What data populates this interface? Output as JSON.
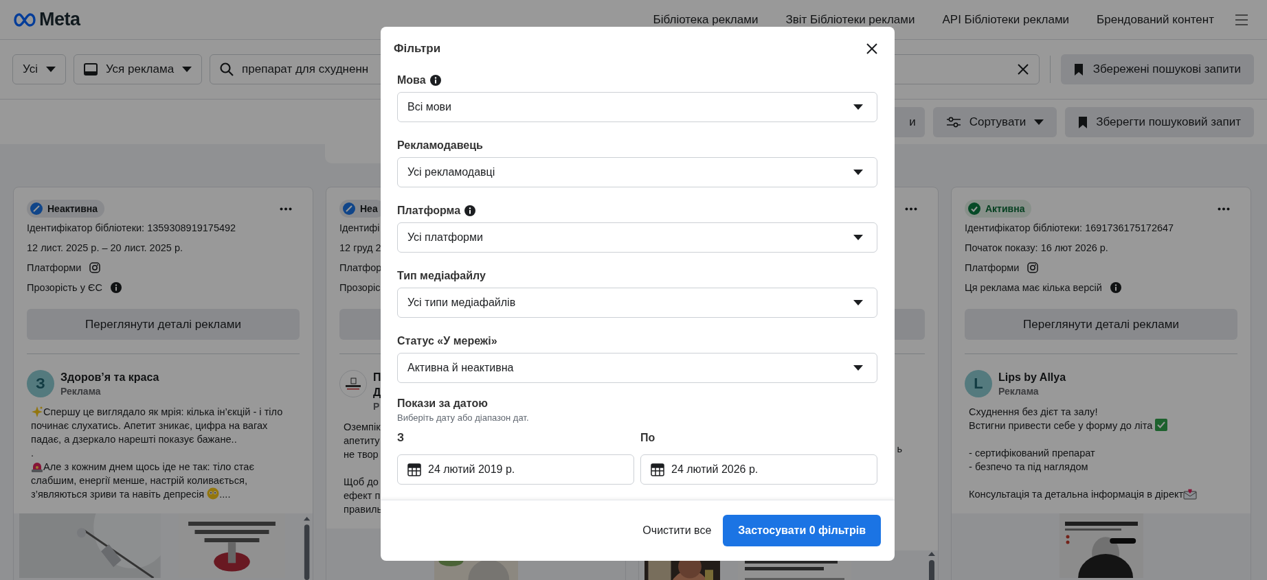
{
  "header": {
    "logo": "Meta",
    "nav": [
      "Бібліотека реклами",
      "Звіт Бібліотеки реклами",
      "API Бібліотеки реклами",
      "Брендований контент"
    ]
  },
  "search_bar": {
    "country": "Усі",
    "ad_category": "Уся реклама",
    "query": "препарат для схудненн",
    "saved_searches": "Збережені пошукові запити"
  },
  "filter_bar": {
    "buttons": [
      {
        "kind": "partial",
        "label": "и"
      },
      {
        "kind": "sort",
        "label": "Сортувати"
      },
      {
        "kind": "save",
        "label": "Зберегти пошуковий запит"
      }
    ]
  },
  "cards": [
    {
      "status": {
        "label": "Неактивна",
        "active": false
      },
      "lines": [
        {
          "kind": "plain",
          "text": "Ідентифікатор бібліотеки: 1359308919175492"
        },
        {
          "kind": "plain",
          "text": "12 лист. 2025 р. – 20 лист. 2025 р."
        },
        {
          "kind": "instagram",
          "text": "Платформи"
        },
        {
          "kind": "info",
          "text": "Прозорість у ЄС"
        }
      ],
      "details": "Переглянути деталі реклами",
      "advertiser": {
        "kind": "letter",
        "initial": "З",
        "name": "Здоров’я та краса",
        "label": "Реклама"
      },
      "post": [
        {
          "segments": [
            {
              "kind": "sparkle"
            },
            {
              "kind": "text",
              "text": "Спершу це виглядало як мрія: кілька ін’єкцій - і тіло починає слухатись. Апетит зникає, цифра на вагах падає, а дзеркало нарешті показує бажане..\n.\n"
            },
            {
              "kind": "siren"
            },
            {
              "kind": "text",
              "text": "Але з кожним днем щось іде не так: тіло стає слабшим, енергії менше, настрій коливається, з’являються зриви та навіть депресія "
            },
            {
              "kind": "flushed"
            },
            {
              "kind": "text",
              "text": "...."
            }
          ]
        }
      ],
      "media": [
        {
          "kind": "picture"
        },
        {
          "kind": "picture"
        }
      ]
    },
    {
      "status": {
        "label": "Неа",
        "active": false
      },
      "lines": [
        {
          "kind": "plain",
          "text": "Ідентифі"
        },
        {
          "kind": "plain",
          "text": "12 груд 2"
        },
        {
          "kind": "plain",
          "text": "Платфор"
        },
        {
          "kind": "plain",
          "text": "Прозоріс"
        }
      ],
      "advertiser": {
        "kind": "logo",
        "name": "П\nД",
        "label": "Р"
      },
      "post": [
        {
          "segments": [
            {
              "kind": "text",
              "text": "Оземпік\nапетиту\nне твор"
            }
          ]
        },
        {
          "segments": [
            {
              "kind": "text",
              "text": "Щоб до\nефект п\nправиль"
            }
          ]
        }
      ],
      "media": [
        {
          "kind": "picture"
        }
      ]
    },
    {
      "kind": "partial",
      "post": [
        {
          "segments": [
            {
              "kind": "text",
              "text": "ь"
            }
          ]
        }
      ],
      "media": [
        {
          "kind": "picture"
        },
        {
          "kind": "picture"
        }
      ]
    },
    {
      "status": {
        "label": "Активна",
        "active": true
      },
      "lines": [
        {
          "kind": "plain",
          "text": "Ідентифікатор бібліотеки: 1691736175172647"
        },
        {
          "kind": "plain",
          "text": "Початок показу: 16 лют 2026 р."
        },
        {
          "kind": "instagram",
          "text": "Платформи"
        },
        {
          "kind": "info",
          "text": "Ця реклама має кілька версій"
        }
      ],
      "details": "Переглянути деталі реклами",
      "advertiser": {
        "kind": "letter",
        "initial": "L",
        "name": "Lips by Allya",
        "label": "Реклама"
      },
      "post": [
        {
          "segments": [
            {
              "kind": "text",
              "text": "Схуднення без дієт та залу!\nВстигни привести себе у форму до літа "
            },
            {
              "kind": "check"
            }
          ]
        },
        {
          "segments": [
            {
              "kind": "text",
              "text": "- сертифікований препарат\n- безпечо та під наглядом"
            }
          ]
        },
        {
          "segments": [
            {
              "kind": "text",
              "text": "Консультація та детальна інформація в дірект"
            },
            {
              "kind": "envelope"
            }
          ]
        }
      ],
      "media": [
        {
          "kind": "picture"
        }
      ]
    }
  ],
  "filters_dialog": {
    "title": "Фільтри",
    "fields": [
      {
        "label": "Мова",
        "info": true,
        "value": "Всі мови"
      },
      {
        "label": "Рекламодавець",
        "info": false,
        "value": "Усі рекламодавці"
      },
      {
        "label": "Платформа",
        "info": true,
        "value": "Усі платформи"
      },
      {
        "label": "Тип медіафайлу",
        "info": false,
        "value": "Усі типи медіафайлів"
      },
      {
        "label": "Статус «У мережі»",
        "info": false,
        "value": "Активна й неактивна"
      }
    ],
    "date_range": {
      "label": "Покази за датою",
      "hint": "Виберіть дату або діапазон дат.",
      "from_label": "З",
      "from": "24 лютий 2019 р.",
      "to_label": "По",
      "to": "24 лютий 2026 р."
    },
    "clear": "Очистити все",
    "apply": "Застосувати 0 фільтрів"
  }
}
